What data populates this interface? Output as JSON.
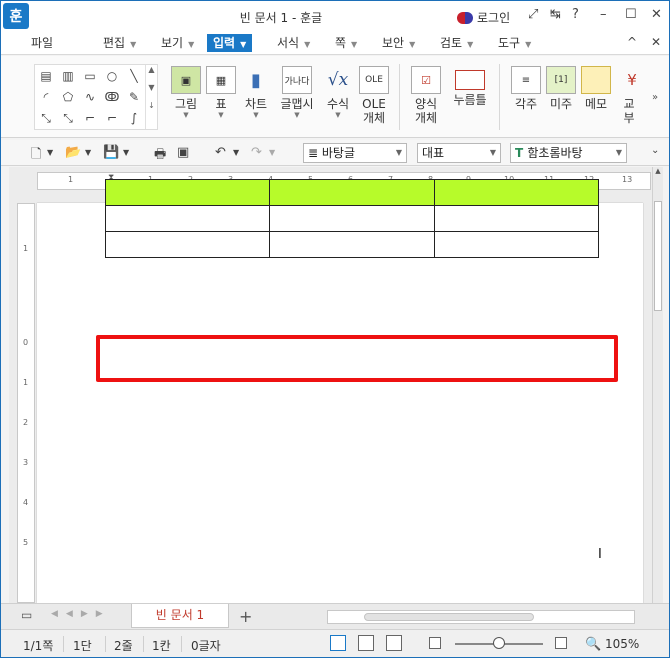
{
  "window": {
    "logo": "훈",
    "title": "빈 문서 1 - 훈글",
    "login": "로그인",
    "controls": [
      "⤢",
      "↹",
      "?",
      "–",
      "☐",
      "✕"
    ]
  },
  "menu": {
    "items": [
      "파일",
      "편집",
      "보기",
      "입력",
      "서식",
      "쪽",
      "보안",
      "검토",
      "도구"
    ],
    "active": "입력",
    "right": [
      "^",
      "✕"
    ]
  },
  "ribbon": {
    "buttons": [
      {
        "label": "그림",
        "icon": "picture-icon"
      },
      {
        "label": "표",
        "icon": "table-icon"
      },
      {
        "label": "차트",
        "icon": "chart-icon"
      },
      {
        "label": "글맵시",
        "icon": "wordart-icon"
      },
      {
        "label": "수식",
        "icon": "formula-icon"
      },
      {
        "label": "OLE\n개체",
        "icon": "ole-icon"
      },
      {
        "label": "양식\n개체",
        "icon": "form-icon"
      },
      {
        "label": "누름틀",
        "icon": "field-icon"
      },
      {
        "label": "각주",
        "icon": "footnote-icon"
      },
      {
        "label": "미주",
        "icon": "endnote-icon"
      },
      {
        "label": "메모",
        "icon": "memo-icon"
      },
      {
        "label": "교\n부",
        "icon": "cross-ref-icon"
      }
    ],
    "more": "»"
  },
  "toolbar": {
    "style_combo": "바탕글",
    "lang_combo": "대표",
    "font_combo": "함초롬바탕"
  },
  "ruler": {
    "h_numbers": [
      "1",
      "1",
      "2",
      "3",
      "4",
      "5",
      "6",
      "7",
      "8",
      "9",
      "10",
      "11",
      "12",
      "13"
    ],
    "v_numbers": [
      "1",
      "0",
      "1",
      "2",
      "3",
      "4",
      "5"
    ]
  },
  "document": {
    "table": {
      "rows": 3,
      "cols": 3,
      "highlight_color": "#b7fb2a",
      "highlight_row": 0
    },
    "annotation_color": "#ee1111"
  },
  "tabs": {
    "doc_tab": "빈 문서 1",
    "add": "+"
  },
  "status": {
    "page": "1/1쪽",
    "section": "1단",
    "line": "2줄",
    "column": "1칸",
    "chars": "0글자",
    "zoom": "105%",
    "zoom_slider": 0.5
  }
}
